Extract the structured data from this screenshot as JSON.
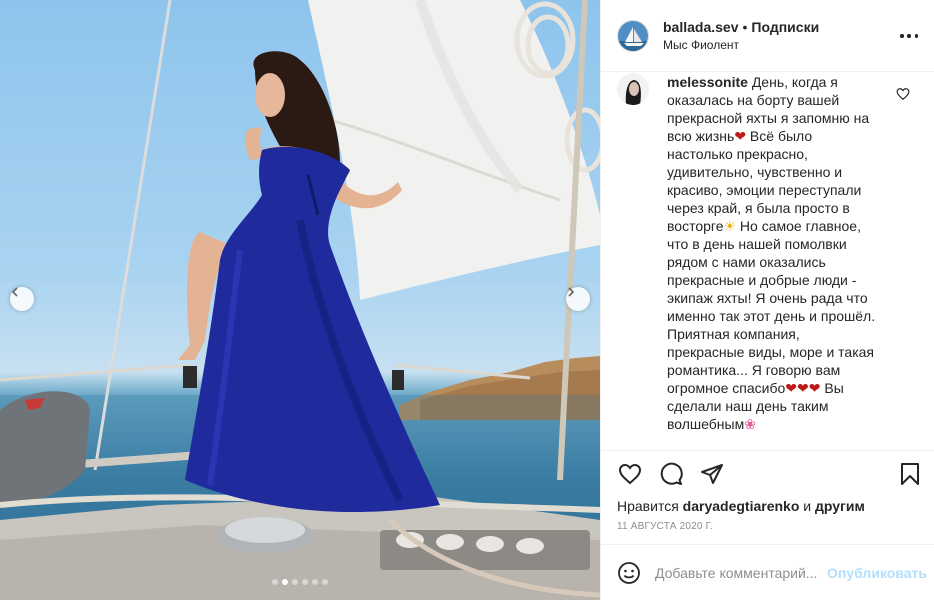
{
  "post": {
    "owner_username": "ballada.sev",
    "bullet": "•",
    "follow_label": "Подписки",
    "location": "Мыс Фиолент",
    "more_icon": "more-horizontal-icon"
  },
  "photo": {
    "description_icon": "photo",
    "carousel_dot_count": 6,
    "carousel_active_dot": 1
  },
  "caption": {
    "username": "melessonite",
    "segments": [
      "День, когда я оказалась на борту вашей прекрасной яхты я запомню на всю жизнь",
      "❤",
      " Всё было настолько прекрасно, удивительно, чувственно и красиво, эмоции переступали через край, я была просто в восторге",
      "☀",
      " Но самое главное, что в день нашей помолвки рядом с нами оказались прекрасные и добрые люди - экипаж яхты! Я очень рада что именно так этот день и прошёл. Приятная компания, прекрасные виды, море и такая романтика... Я говорю вам огромное спасибо",
      "❤❤❤",
      " Вы сделали наш день таким волшебным",
      "❀"
    ]
  },
  "likes": {
    "prefix": "Нравится",
    "user": "daryadegtiarenko",
    "connector": "и",
    "others": "другим"
  },
  "date": "11 августа 2020 г.",
  "add_comment": {
    "placeholder": "Добавьте комментарий...",
    "publish_label": "Опубликовать"
  },
  "colors": {
    "publish_disabled": "#b2dffc",
    "dress": "#1f2b9c",
    "heart_emoji": "#be1a1a"
  }
}
